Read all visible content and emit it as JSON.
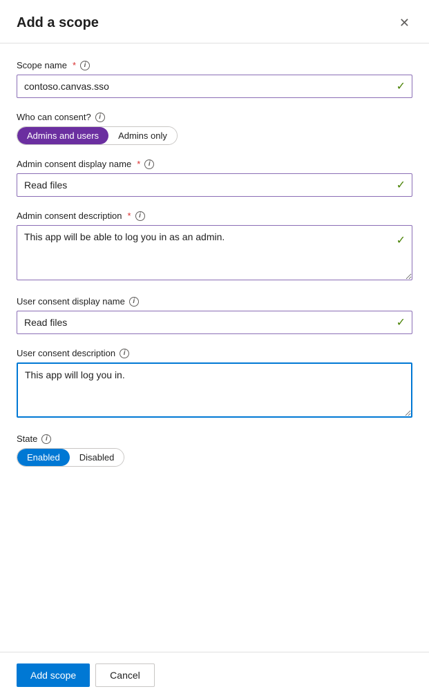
{
  "modal": {
    "title": "Add a scope",
    "close_label": "✕"
  },
  "form": {
    "scope_name_label": "Scope name",
    "scope_name_value": "contoso.canvas.sso",
    "who_can_consent_label": "Who can consent?",
    "consent_options": [
      {
        "label": "Admins and users",
        "active": true
      },
      {
        "label": "Admins only",
        "active": false
      }
    ],
    "admin_consent_display_name_label": "Admin consent display name",
    "admin_consent_display_name_value": "Read files",
    "admin_consent_description_label": "Admin consent description",
    "admin_consent_description_value": "This app will be able to log you in as an admin.",
    "user_consent_display_name_label": "User consent display name",
    "user_consent_display_name_value": "Read files",
    "user_consent_description_label": "User consent description",
    "user_consent_description_value": "This app will log you in.",
    "state_label": "State",
    "state_options": [
      {
        "label": "Enabled",
        "active": true
      },
      {
        "label": "Disabled",
        "active": false
      }
    ]
  },
  "footer": {
    "add_scope_label": "Add scope",
    "cancel_label": "Cancel"
  },
  "icons": {
    "info": "i",
    "check": "✓",
    "close": "✕"
  }
}
